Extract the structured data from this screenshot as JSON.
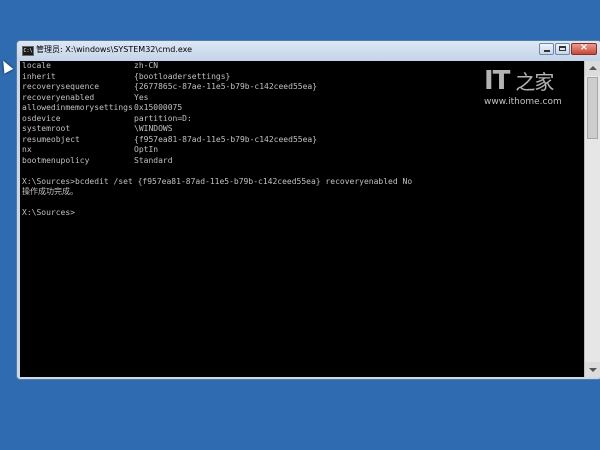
{
  "window": {
    "title": "管理员: X:\\windows\\SYSTEM32\\cmd.exe",
    "icon_label": "C:\\"
  },
  "console": {
    "entries": [
      {
        "key": "locale",
        "value": "zh-CN"
      },
      {
        "key": "inherit",
        "value": "{bootloadersettings}"
      },
      {
        "key": "recoverysequence",
        "value": "{2677865c-87ae-11e5-b79b-c142ceed55ea}"
      },
      {
        "key": "recoveryenabled",
        "value": "Yes"
      },
      {
        "key": "allowedinmemorysettings",
        "value": "0x15000075"
      },
      {
        "key": "osdevice",
        "value": "partition=D:"
      },
      {
        "key": "systemroot",
        "value": "\\WINDOWS"
      },
      {
        "key": "resumeobject",
        "value": "{f957ea81-87ad-11e5-b79b-c142ceed55ea}"
      },
      {
        "key": "nx",
        "value": "OptIn"
      },
      {
        "key": "bootmenupolicy",
        "value": "Standard"
      }
    ],
    "command_line": "X:\\Sources>bcdedit /set {f957ea81-87ad-11e5-b79b-c142ceed55ea} recoveryenabled No",
    "result_line": "操作成功完成。",
    "prompt_line": "X:\\Sources>"
  },
  "watermark": {
    "logo": "IT",
    "logo_glyph": "之家",
    "url": "www.ithome.com"
  },
  "colors": {
    "desktop": "#2f6bb0",
    "console_bg": "#000000",
    "console_text": "#c0c0c0"
  },
  "icons": {
    "window_icon": "cmd-icon",
    "minimize": "minimize-icon",
    "maximize": "maximize-icon",
    "close": "close-icon"
  }
}
